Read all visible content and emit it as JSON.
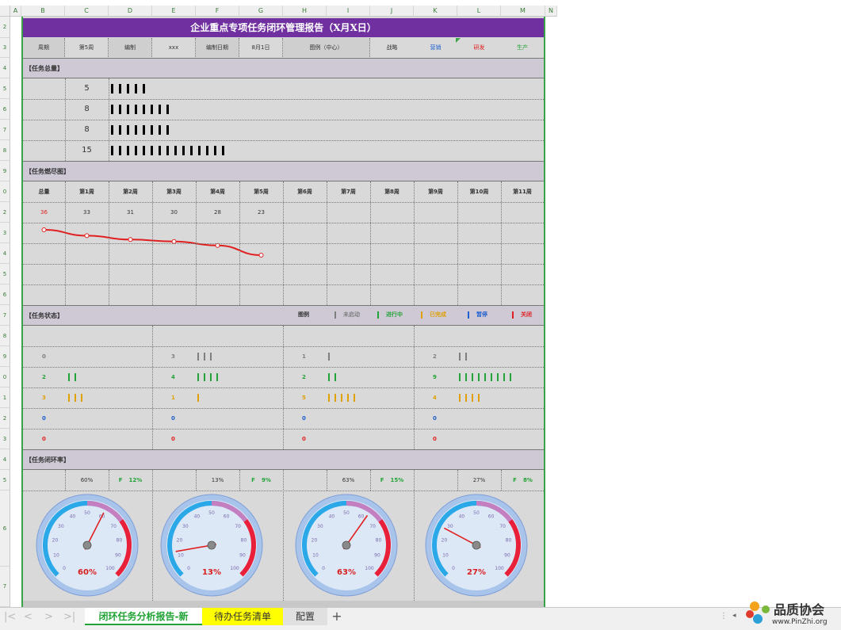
{
  "columns": [
    "A",
    "B",
    "C",
    "D",
    "E",
    "F",
    "G",
    "H",
    "I",
    "J",
    "K",
    "L",
    "M",
    "N"
  ],
  "rows": [
    "2",
    "3",
    "4",
    "5",
    "6",
    "7",
    "8",
    "9",
    "0",
    "2",
    "3",
    "4",
    "5",
    "6",
    "7",
    "8",
    "9",
    "0",
    "1",
    "2",
    "3",
    "4",
    "5",
    "6",
    "7"
  ],
  "title": "企业重点专项任务闭环管理报告（X月X日）",
  "info": {
    "period_label": "周期",
    "period_value": "第5周",
    "editor_label": "编制",
    "editor_value": "xxx",
    "date_label": "编制日期",
    "date_value": "8月1日",
    "legend_label": "图例（中心）",
    "cat1": "战略",
    "cat2": "营销",
    "cat3": "研发",
    "cat4": "生产"
  },
  "section1": {
    "title": "【任务总量】",
    "values": [
      5,
      8,
      8,
      15
    ]
  },
  "section2": {
    "title": "【任务燃尽图】",
    "headers": [
      "总量",
      "第1周",
      "第2周",
      "第3周",
      "第4周",
      "第5周",
      "第6周",
      "第7周",
      "第8周",
      "第9周",
      "第10周",
      "第11周"
    ],
    "values": [
      "36",
      "33",
      "31",
      "30",
      "28",
      "23"
    ]
  },
  "chart_data": {
    "type": "line",
    "categories": [
      "总量",
      "第1周",
      "第2周",
      "第3周",
      "第4周",
      "第5周"
    ],
    "values": [
      36,
      33,
      31,
      30,
      28,
      23
    ],
    "color": "#e02020"
  },
  "section3": {
    "title": "【任务状态】",
    "legend_title": "图例",
    "legend": [
      {
        "name": "未启动",
        "color": "#7f7f7f"
      },
      {
        "name": "进行中",
        "color": "#21a336"
      },
      {
        "name": "已完成",
        "color": "#e0a000"
      },
      {
        "name": "暂停",
        "color": "#1f5fd0"
      },
      {
        "name": "关闭",
        "color": "#e02020"
      }
    ],
    "groups": [
      {
        "counts": [
          "0",
          "2",
          "3",
          "0",
          "0"
        ]
      },
      {
        "counts": [
          "3",
          "4",
          "1",
          "0",
          "0"
        ]
      },
      {
        "counts": [
          "1",
          "2",
          "5",
          "0",
          "0"
        ]
      },
      {
        "counts": [
          "2",
          "9",
          "4",
          "0",
          "0"
        ]
      }
    ]
  },
  "section4": {
    "title": "【任务闭环率】",
    "groups": [
      {
        "pct": "60%",
        "f": "F",
        "fpct": "12%",
        "value": 60
      },
      {
        "pct": "13%",
        "f": "F",
        "fpct": "9%",
        "value": 13
      },
      {
        "pct": "63%",
        "f": "F",
        "fpct": "15%",
        "value": 63
      },
      {
        "pct": "27%",
        "f": "F",
        "fpct": "8%",
        "value": 27
      }
    ],
    "scale": [
      "0",
      "10",
      "20",
      "30",
      "40",
      "50",
      "60",
      "70",
      "80",
      "90",
      "100"
    ]
  },
  "tabs": {
    "tab1": "闭环任务分析报告-新",
    "tab2": "待办任务清单",
    "tab3": "配置",
    "add": "+"
  },
  "watermark": {
    "name": "品质协会",
    "url": "www.PinZhi.org"
  }
}
